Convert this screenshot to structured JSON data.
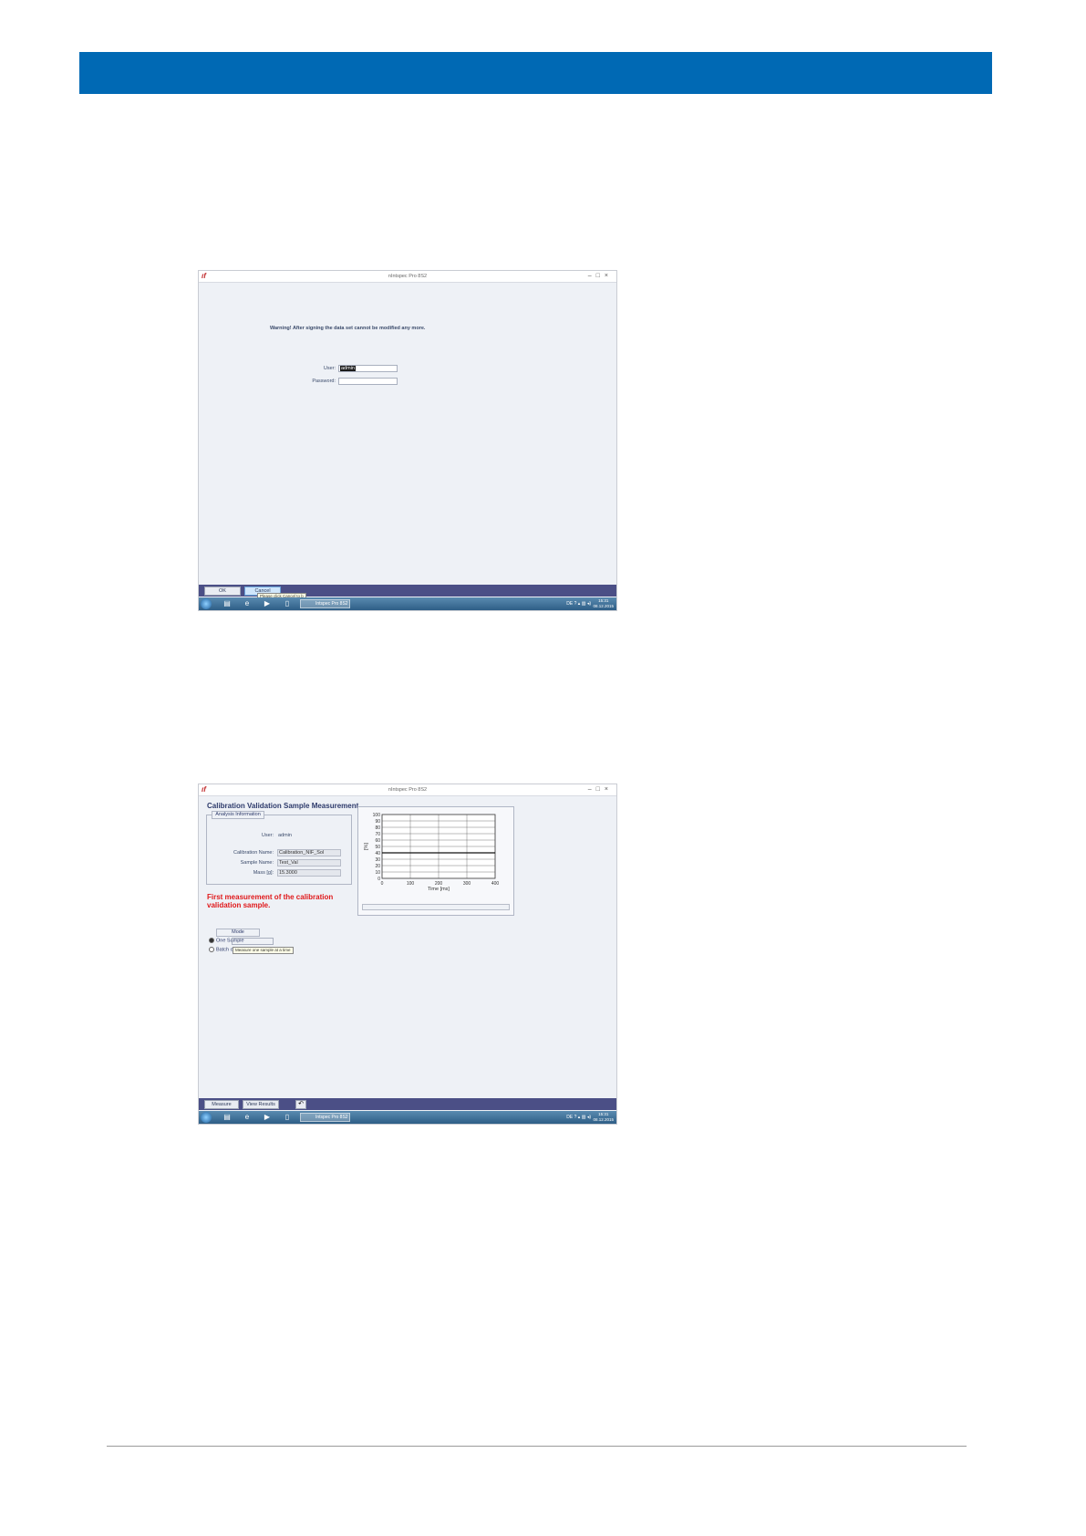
{
  "shot1": {
    "window_title": "nIntspec Pro 8S2",
    "warning": "Warning! After signing the data set cannot be modified any more.",
    "user_label": "User:",
    "user_value": "admin",
    "password_label": "Password:",
    "ok_label": "OK",
    "cancel_label": "Cancel",
    "tooltip": "Please click Cancel to b",
    "taskbar_app": "Intspec Pro 8S2",
    "tray_lang": "DE",
    "clock_time": "15:31",
    "clock_date": "08.12.2015"
  },
  "shot2": {
    "window_title": "nIntspec Pro 8S2",
    "screen_title": "Calibration Validation Sample Measurement",
    "group_title": "Analysis Information",
    "user_label": "User:",
    "user_value": "admin",
    "calibration_name_label": "Calibration Name:",
    "calibration_name_value": "Calibration_NIF_Sol",
    "sample_name_label": "Sample Name:",
    "sample_name_value": "Test_Val",
    "mass_label": "Mass [g]:",
    "mass_value": "15.3000",
    "message": "First measurement of the calibration validation sample.",
    "mode_title": "Mode",
    "mode_option1": "One Sample",
    "mode_option2": "Batch of",
    "mode_tooltip": "Measure one sample at a time",
    "measure_label": "Measure",
    "view_results_label": "View Results",
    "taskbar_app": "Intspec Pro 8S2",
    "tray_lang": "DE",
    "clock_time": "15:31",
    "clock_date": "08.12.2015"
  },
  "chart_data": {
    "type": "line",
    "ylabel": "[%]",
    "xlabel": "Time [ms]",
    "xlim": [
      0,
      400
    ],
    "ylim": [
      0,
      100
    ],
    "xticks": [
      0,
      100,
      200,
      300,
      400
    ],
    "yticks": [
      0,
      10,
      20,
      30,
      40,
      50,
      60,
      70,
      80,
      90,
      100
    ],
    "grid": true,
    "series": [],
    "reference_line_y": 40
  }
}
